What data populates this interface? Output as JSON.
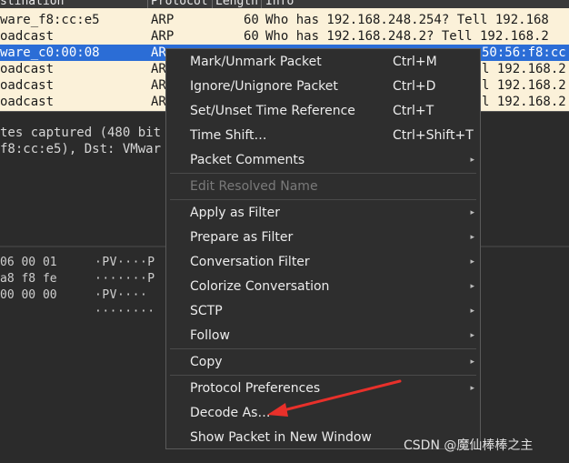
{
  "packet_list": {
    "columns": {
      "destination": "stination",
      "protocol": "Protocol",
      "length": "Length",
      "info": "Info"
    },
    "rows": [
      {
        "dst": "ware_f8:cc:e5",
        "proto": "ARP",
        "len": "60",
        "info": "Who has 192.168.248.254? Tell 192.168",
        "selected": false
      },
      {
        "dst": "oadcast",
        "proto": "ARP",
        "len": "60",
        "info": "Who has 192.168.248.2? Tell 192.168.2",
        "selected": false
      },
      {
        "dst": "ware_c0:00:08",
        "proto": "AR",
        "len": "",
        "info": "50:56:f8:cc:",
        "selected": true
      },
      {
        "dst": "oadcast",
        "proto": "AR",
        "len": "",
        "info": "l 192.168.2",
        "selected": false
      },
      {
        "dst": "oadcast",
        "proto": "AR",
        "len": "",
        "info": "l 192.168.2",
        "selected": false
      },
      {
        "dst": "oadcast",
        "proto": "AR",
        "len": "",
        "info": "l 192.168.2",
        "selected": false
      }
    ]
  },
  "details": {
    "lines": [
      "tes captured (480 bit",
      "f8:cc:e5), Dst: VMwar"
    ]
  },
  "bytes": {
    "hex_lines": [
      "06 00 01",
      "a8 f8 fe",
      "00 00 00"
    ],
    "ascii_lines": [
      "·PV····P",
      "·······P",
      "·PV····",
      "········"
    ]
  },
  "context_menu": {
    "items": [
      {
        "label": "Mark/Unmark Packet",
        "shortcut": "Ctrl+M",
        "submenu": false,
        "disabled": false
      },
      {
        "label": "Ignore/Unignore Packet",
        "shortcut": "Ctrl+D",
        "submenu": false,
        "disabled": false
      },
      {
        "label": "Set/Unset Time Reference",
        "shortcut": "Ctrl+T",
        "submenu": false,
        "disabled": false
      },
      {
        "label": "Time Shift…",
        "shortcut": "Ctrl+Shift+T",
        "submenu": false,
        "disabled": false
      },
      {
        "label": "Packet Comments",
        "shortcut": "",
        "submenu": true,
        "disabled": false
      },
      {
        "label": "Edit Resolved Name",
        "shortcut": "",
        "submenu": false,
        "disabled": true
      },
      {
        "label": "Apply as Filter",
        "shortcut": "",
        "submenu": true,
        "disabled": false
      },
      {
        "label": "Prepare as Filter",
        "shortcut": "",
        "submenu": true,
        "disabled": false
      },
      {
        "label": "Conversation Filter",
        "shortcut": "",
        "submenu": true,
        "disabled": false
      },
      {
        "label": "Colorize Conversation",
        "shortcut": "",
        "submenu": true,
        "disabled": false
      },
      {
        "label": "SCTP",
        "shortcut": "",
        "submenu": true,
        "disabled": false
      },
      {
        "label": "Follow",
        "shortcut": "",
        "submenu": true,
        "disabled": false
      },
      {
        "label": "Copy",
        "shortcut": "",
        "submenu": true,
        "disabled": false
      },
      {
        "label": "Protocol Preferences",
        "shortcut": "",
        "submenu": true,
        "disabled": false
      },
      {
        "label": "Decode As…",
        "shortcut": "",
        "submenu": false,
        "disabled": false
      },
      {
        "label": "Show Packet in New Window",
        "shortcut": "",
        "submenu": false,
        "disabled": false
      }
    ],
    "submenu_arrow": "▸"
  },
  "annotation": {
    "arrow_color": "#e8302a"
  },
  "watermark": "CSDN @魔仙棒棒之主"
}
